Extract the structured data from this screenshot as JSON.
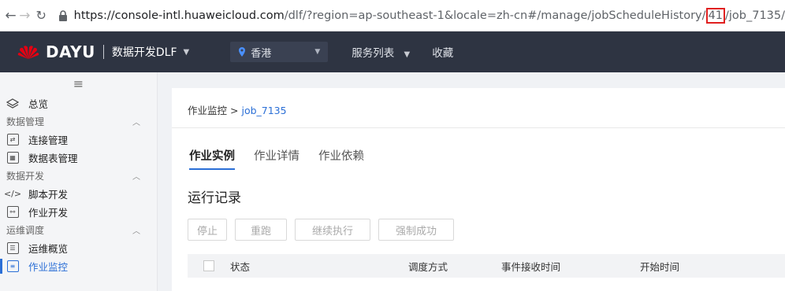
{
  "browser": {
    "url_host": "https://console-intl.huaweicloud.com",
    "url_path_before": "/dlf/?region=ap-southeast-1&locale=zh-cn#/manage/jobScheduleHistory/",
    "url_highlight": "41",
    "url_path_after": "/job_7135/"
  },
  "appbar": {
    "brand": "DAYU",
    "product": "数据开发DLF",
    "region": "香港",
    "services": "服务列表",
    "favorites": "收藏"
  },
  "sidebar": {
    "overview": "总览",
    "groups": [
      {
        "label": "数据管理",
        "items": [
          "连接管理",
          "数据表管理"
        ]
      },
      {
        "label": "数据开发",
        "items": [
          "脚本开发",
          "作业开发"
        ]
      },
      {
        "label": "运维调度",
        "items": [
          "运维概览",
          "作业监控"
        ]
      }
    ]
  },
  "main": {
    "breadcrumb_parent": "作业监控",
    "breadcrumb_sep": ">",
    "breadcrumb_current": "job_7135",
    "tabs": [
      "作业实例",
      "作业详情",
      "作业依赖"
    ],
    "section_title": "运行记录",
    "buttons": [
      "停止",
      "重跑",
      "继续执行",
      "强制成功"
    ],
    "columns": [
      "状态",
      "调度方式",
      "事件接收时间",
      "开始时间"
    ]
  },
  "colors": {
    "accent": "#2b6fd6",
    "appbar": "#2e3442",
    "highlight": "#e02020"
  }
}
